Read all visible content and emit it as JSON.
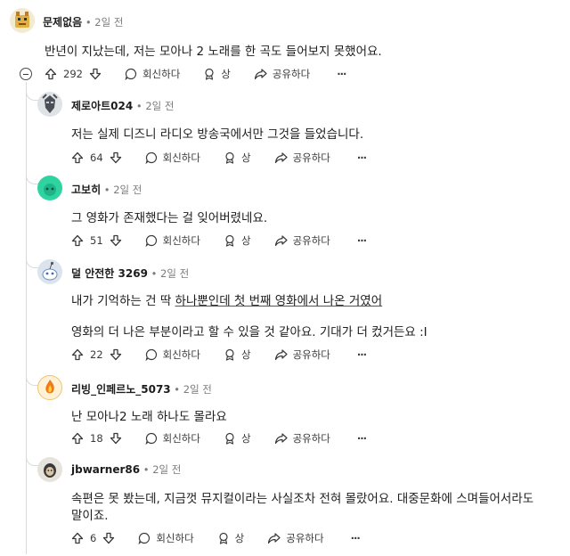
{
  "actions": {
    "reply": "회신하다",
    "award": "상",
    "share": "공유하다",
    "more": "···"
  },
  "comments": [
    {
      "user": "문제없음",
      "sep": " • ",
      "time": "2일 전",
      "lines": [
        "반년이 지났는데, 저는 모아나 2 노래를 한 곡도 들어보지 못했어요."
      ],
      "votes": "292"
    },
    {
      "user": "제로아트024",
      "sep": " • ",
      "time": "2일 전",
      "lines": [
        "저는 실제 디즈니 라디오 방송국에서만 그것을 들었습니다."
      ],
      "votes": "64"
    },
    {
      "user": "고보히",
      "sep": " • ",
      "time": "2일 전",
      "lines": [
        "그 영화가 존재했다는 걸 잊어버렸네요."
      ],
      "votes": "51"
    },
    {
      "user": "덜 안전한 3269",
      "sep": " • ",
      "time": "2일 전",
      "line1_pre": "내가 기억하는 건 딱 ",
      "line1_link": "하나뿐인데 첫 번째 영화에서 나온 거였어",
      "lines": [
        "영화의 더 나은 부분이라고 할 수 있을 것 같아요. 기대가 더 컸거든요 :I"
      ],
      "votes": "22"
    },
    {
      "user": "리빙_인페르노_5073",
      "sep": " • ",
      "time": "2일 전",
      "lines": [
        "난 모아나2 노래 하나도 몰라요"
      ],
      "votes": "18"
    },
    {
      "user": "jbwarner86",
      "sep": " • ",
      "time": "2일 전",
      "lines": [
        "속편은 못 봤는데, 지금껏 뮤지컬이라는 사실조차 전혀 몰랐어요. 대중문화에 스며들어서라도",
        "말이죠."
      ],
      "votes": "6"
    }
  ]
}
